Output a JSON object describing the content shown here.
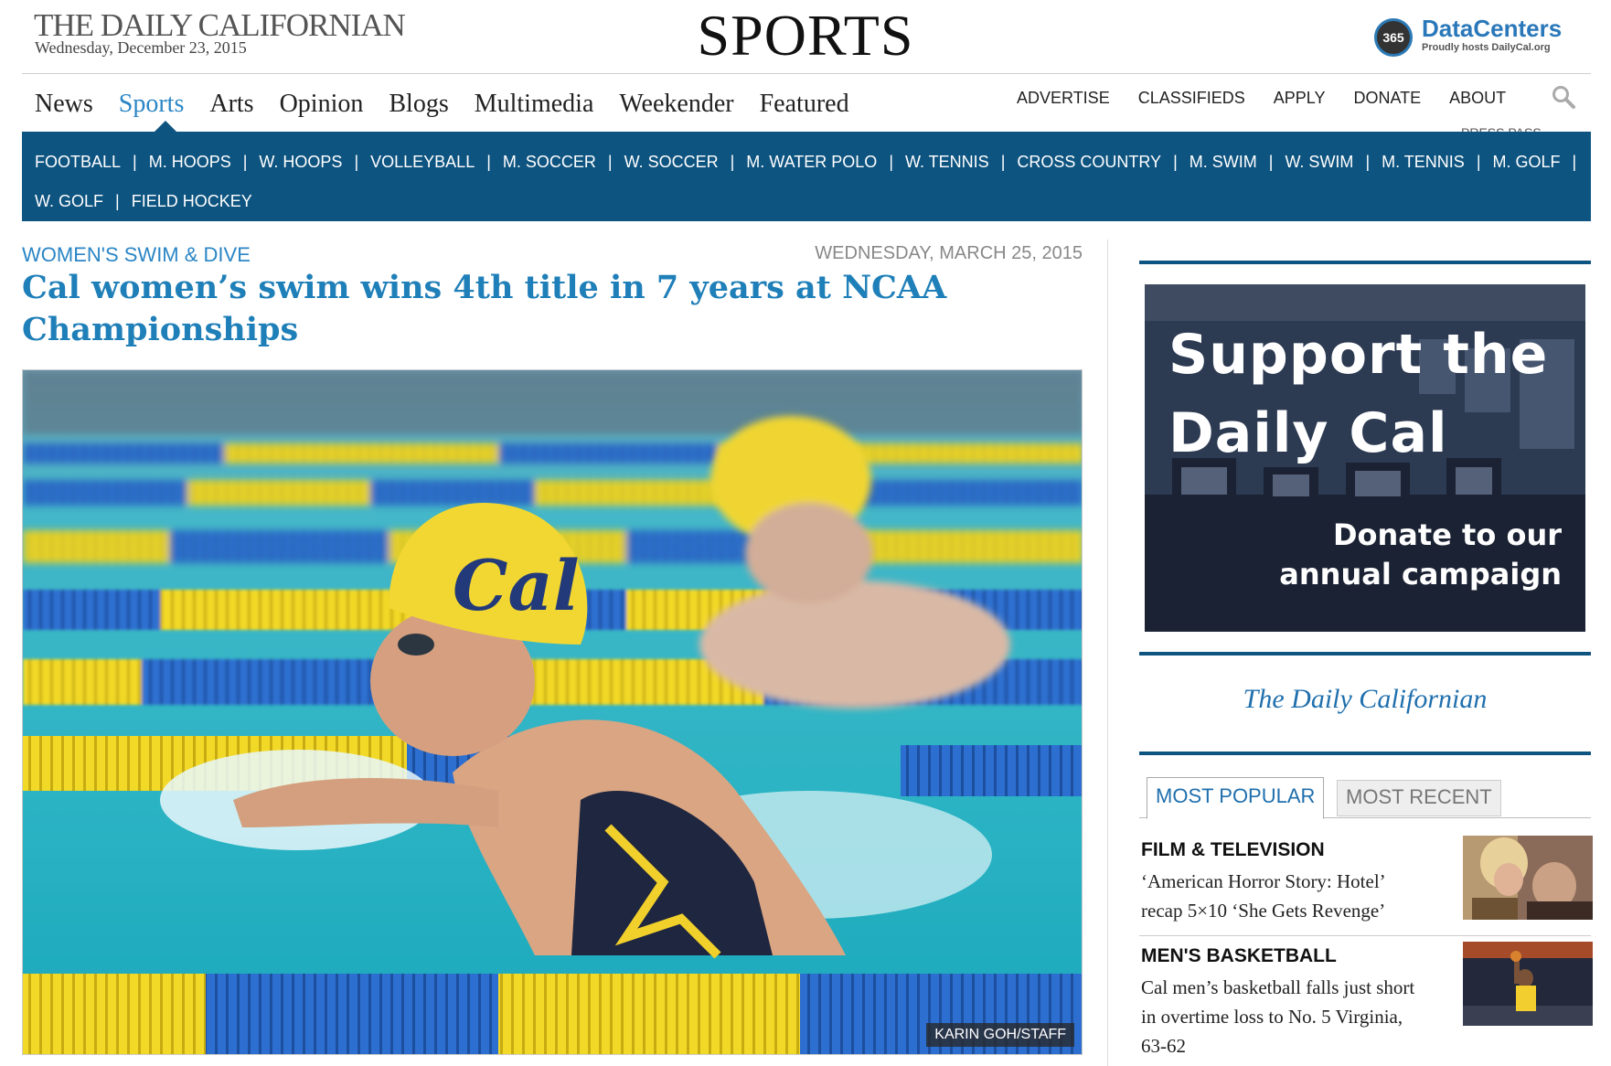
{
  "masthead": {
    "title": "THE DAILY CALIFORNIAN",
    "date": "Wednesday, December 23, 2015",
    "section": "SPORTS",
    "sponsor_badge": "365",
    "sponsor_name": "DataCenters",
    "sponsor_tagline": "Proudly hosts DailyCal.org"
  },
  "primary_nav": [
    "News",
    "Sports",
    "Arts",
    "Opinion",
    "Blogs",
    "Multimedia",
    "Weekender",
    "Featured"
  ],
  "primary_nav_active": "Sports",
  "utility_nav": [
    "ADVERTISE",
    "CLASSIFIEDS",
    "APPLY",
    "DONATE",
    "ABOUT"
  ],
  "utility_overflow": "PRESS PASS",
  "search_icon": "magnifier",
  "sports_nav": {
    "row1": [
      "FOOTBALL",
      "M. HOOPS",
      "W. HOOPS",
      "VOLLEYBALL",
      "M. SOCCER",
      "W. SOCCER",
      "M. WATER POLO",
      "W. TENNIS",
      "CROSS COUNTRY",
      "M. SWIM",
      "W. SWIM",
      "M. TENNIS",
      "M. GOLF"
    ],
    "row2": [
      "W. GOLF",
      "FIELD HOCKEY"
    ],
    "separator": "|"
  },
  "article": {
    "kicker": "WOMEN'S SWIM & DIVE",
    "date": "WEDNESDAY, MARCH 25, 2015",
    "headline": "Cal women’s swim wins 4th title in 7 years at NCAA Championships",
    "photo_credit": "KARIN GOH/STAFF",
    "cap_text": "Cal"
  },
  "sidebar": {
    "ad": {
      "line1": "Support the",
      "line2": "Daily Cal",
      "line3": "Donate to our",
      "line4": "annual campaign"
    },
    "brand": "The Daily Californian",
    "tabs": [
      "MOST POPULAR",
      "MOST RECENT"
    ],
    "active_tab": "MOST POPULAR",
    "stories": [
      {
        "category": "FILM & TELEVISION",
        "title": "‘American Horror Story: Hotel’ recap 5×10 ‘She Gets Revenge’"
      },
      {
        "category": "MEN'S BASKETBALL",
        "title": "Cal men’s basketball falls just short in overtime loss to No. 5 Virginia, 63-62"
      }
    ]
  },
  "colors": {
    "accent": "#2b86c5",
    "nav_bar": "#0e5480",
    "headline": "#1f7fb8",
    "sponsor": "#2a78b9"
  }
}
